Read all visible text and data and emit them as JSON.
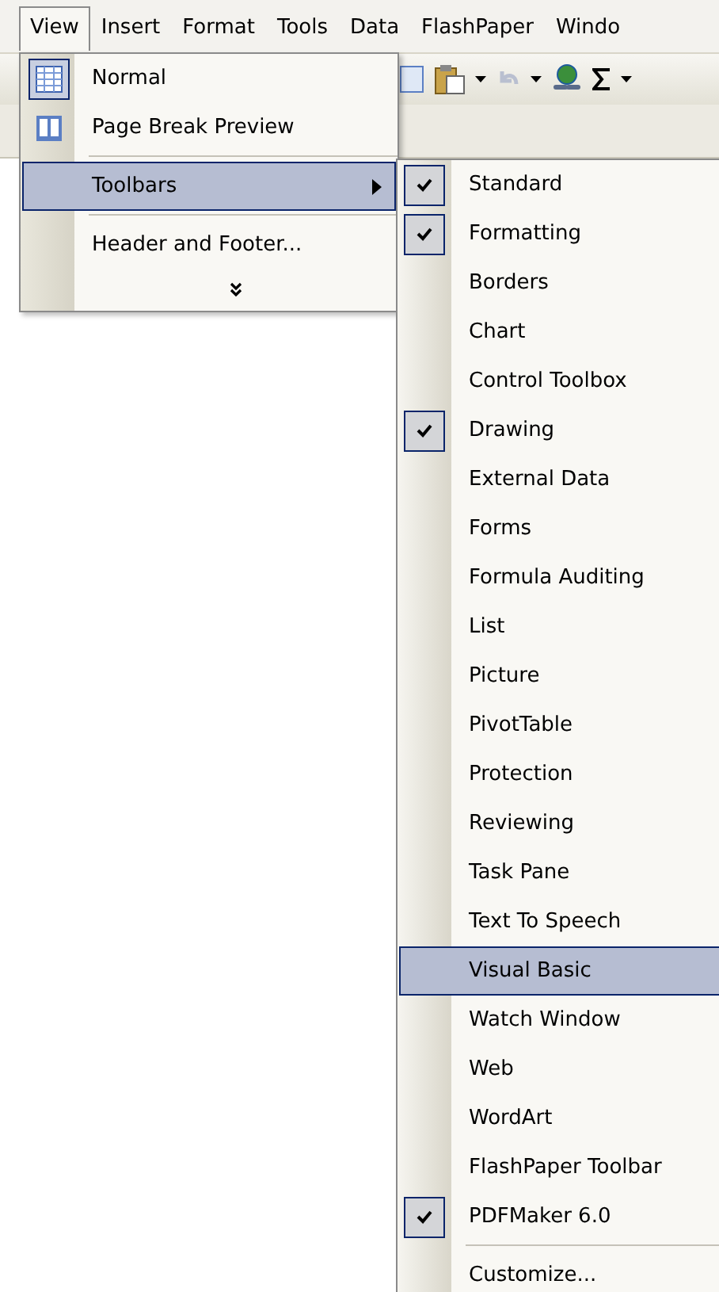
{
  "menu_bar": [
    {
      "label": "View",
      "selected": true
    },
    {
      "label": "Insert",
      "selected": false
    },
    {
      "label": "Format",
      "selected": false
    },
    {
      "label": "Tools",
      "selected": false
    },
    {
      "label": "Data",
      "selected": false
    },
    {
      "label": "FlashPaper",
      "selected": false
    },
    {
      "label": "Windo",
      "selected": false
    }
  ],
  "view_menu": [
    {
      "kind": "grid",
      "label": "Normal",
      "checked": true,
      "selected": false
    },
    {
      "kind": "pages",
      "label": "Page Break Preview",
      "checked": false,
      "selected": false
    },
    {
      "kind": "separator"
    },
    {
      "kind": "submenu",
      "label": "Toolbars",
      "selected": true
    },
    {
      "kind": "separator"
    },
    {
      "kind": "item",
      "label": "Header and Footer...",
      "selected": false
    },
    {
      "kind": "more"
    }
  ],
  "toolbars_menu": [
    {
      "kind": "item",
      "label": "Standard",
      "checked": true,
      "selected": false
    },
    {
      "kind": "item",
      "label": "Formatting",
      "checked": true,
      "selected": false
    },
    {
      "kind": "item",
      "label": "Borders",
      "checked": false,
      "selected": false
    },
    {
      "kind": "item",
      "label": "Chart",
      "checked": false,
      "selected": false
    },
    {
      "kind": "item",
      "label": "Control Toolbox",
      "checked": false,
      "selected": false
    },
    {
      "kind": "item",
      "label": "Drawing",
      "checked": true,
      "selected": false
    },
    {
      "kind": "item",
      "label": "External Data",
      "checked": false,
      "selected": false
    },
    {
      "kind": "item",
      "label": "Forms",
      "checked": false,
      "selected": false
    },
    {
      "kind": "item",
      "label": "Formula Auditing",
      "checked": false,
      "selected": false
    },
    {
      "kind": "item",
      "label": "List",
      "checked": false,
      "selected": false
    },
    {
      "kind": "item",
      "label": "Picture",
      "checked": false,
      "selected": false
    },
    {
      "kind": "item",
      "label": "PivotTable",
      "checked": false,
      "selected": false
    },
    {
      "kind": "item",
      "label": "Protection",
      "checked": false,
      "selected": false
    },
    {
      "kind": "item",
      "label": "Reviewing",
      "checked": false,
      "selected": false
    },
    {
      "kind": "item",
      "label": "Task Pane",
      "checked": false,
      "selected": false
    },
    {
      "kind": "item",
      "label": "Text To Speech",
      "checked": false,
      "selected": false
    },
    {
      "kind": "item",
      "label": "Visual Basic",
      "checked": false,
      "selected": true
    },
    {
      "kind": "item",
      "label": "Watch Window",
      "checked": false,
      "selected": false
    },
    {
      "kind": "item",
      "label": "Web",
      "checked": false,
      "selected": false
    },
    {
      "kind": "item",
      "label": "WordArt",
      "checked": false,
      "selected": false
    },
    {
      "kind": "item",
      "label": "FlashPaper Toolbar",
      "checked": false,
      "selected": false
    },
    {
      "kind": "item",
      "label": "PDFMaker 6.0",
      "checked": true,
      "selected": false
    },
    {
      "kind": "separator"
    },
    {
      "kind": "item",
      "label": "Customize...",
      "checked": false,
      "selected": false
    }
  ]
}
